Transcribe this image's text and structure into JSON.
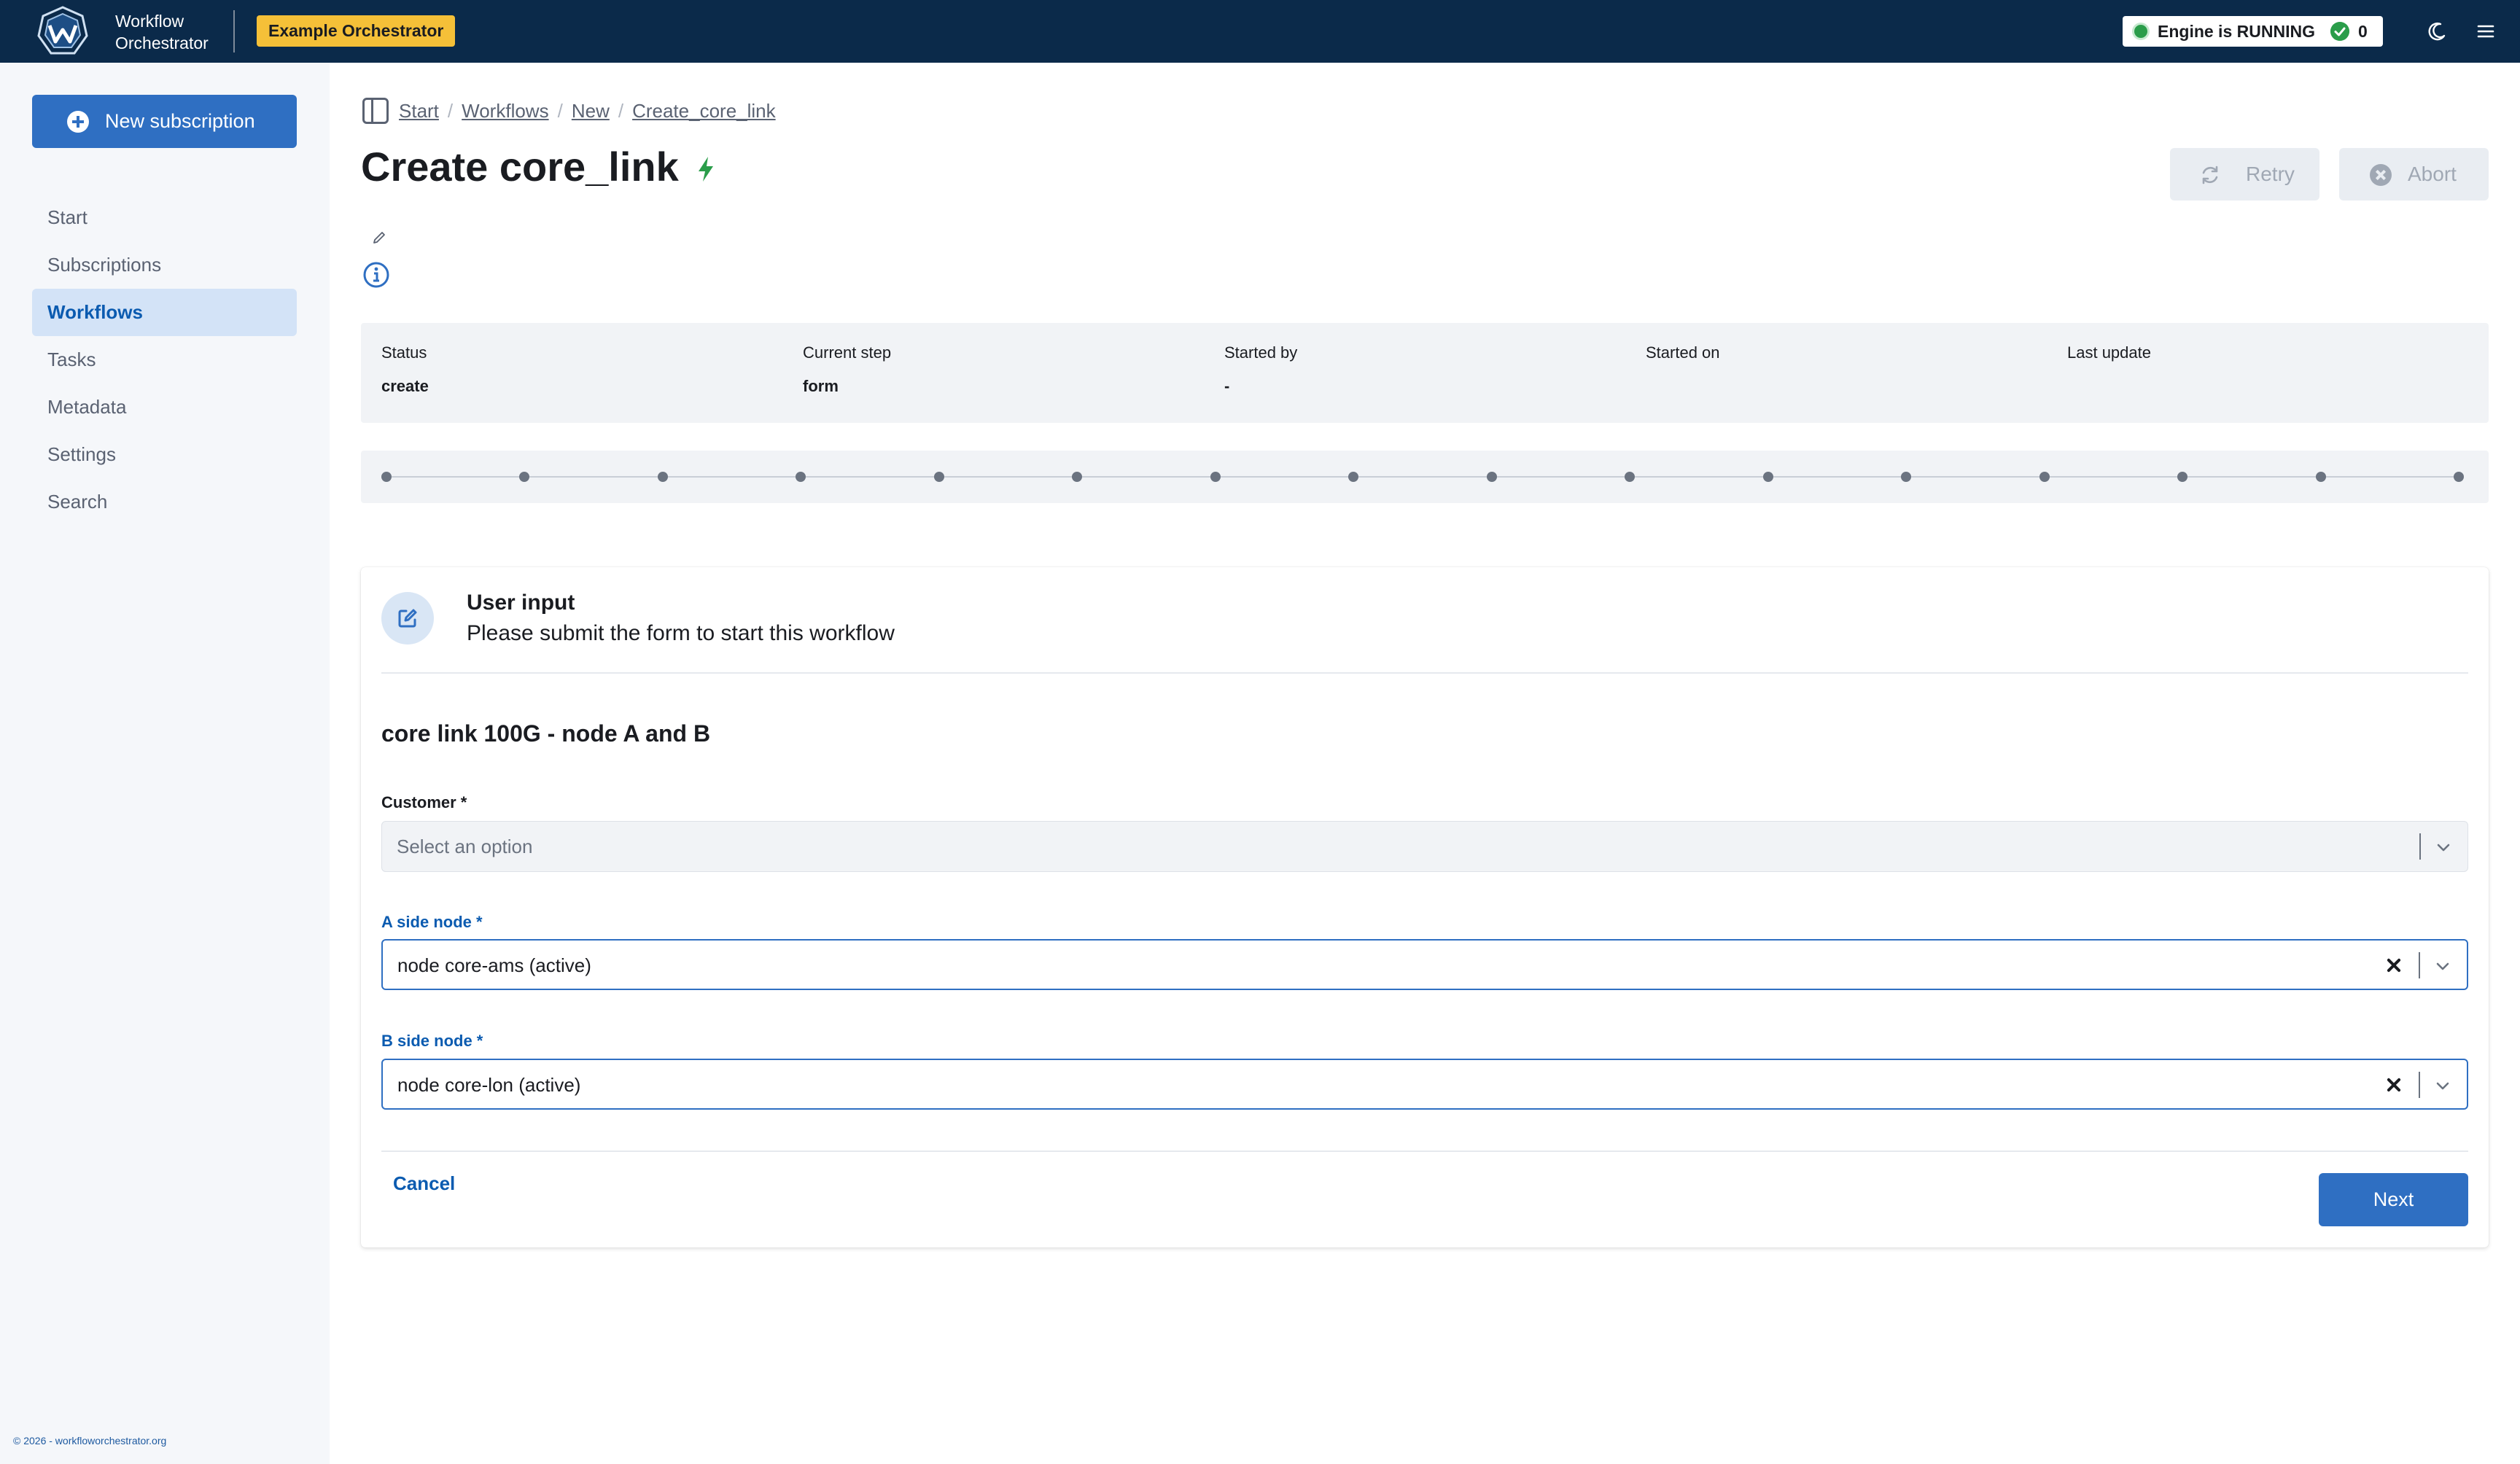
{
  "topbar": {
    "brand_line1": "Workflow",
    "brand_line2": "Orchestrator",
    "env_badge": "Example Orchestrator",
    "engine_status": "Engine is RUNNING",
    "counter": "0"
  },
  "sidebar": {
    "new_subscription": "New subscription",
    "items": [
      {
        "label": "Start"
      },
      {
        "label": "Subscriptions"
      },
      {
        "label": "Workflows"
      },
      {
        "label": "Tasks"
      },
      {
        "label": "Metadata"
      },
      {
        "label": "Settings"
      },
      {
        "label": "Search"
      }
    ],
    "active_item": "Workflows",
    "footer": "© 2026 - workfloworchestrator.org"
  },
  "breadcrumb": [
    "Start",
    "Workflows",
    "New",
    "Create_core_link"
  ],
  "page": {
    "title": "Create core_link",
    "retry_label": "Retry",
    "abort_label": "Abort"
  },
  "status": {
    "status_label": "Status",
    "status_value": "create",
    "current_step_label": "Current step",
    "current_step_value": "form",
    "started_by_label": "Started by",
    "started_by_value": "-",
    "started_on_label": "Started on",
    "last_update_label": "Last update"
  },
  "steps": {
    "count": 16
  },
  "form": {
    "header_title": "User input",
    "header_subtitle": "Please submit the form to start this workflow",
    "title": "core link 100G - node A and B",
    "customer_label": "Customer *",
    "customer_placeholder": "Select an option",
    "a_side_label": "A side node *",
    "a_side_value": "node core-ams (active)",
    "b_side_label": "B side node *",
    "b_side_value": "node core-lon (active)",
    "cancel_label": "Cancel",
    "next_label": "Next"
  },
  "colors": {
    "topbar": "#0b2a4a",
    "primary": "#2f6fc2",
    "env_badge": "#f5c038",
    "running": "#2a9d4a"
  }
}
